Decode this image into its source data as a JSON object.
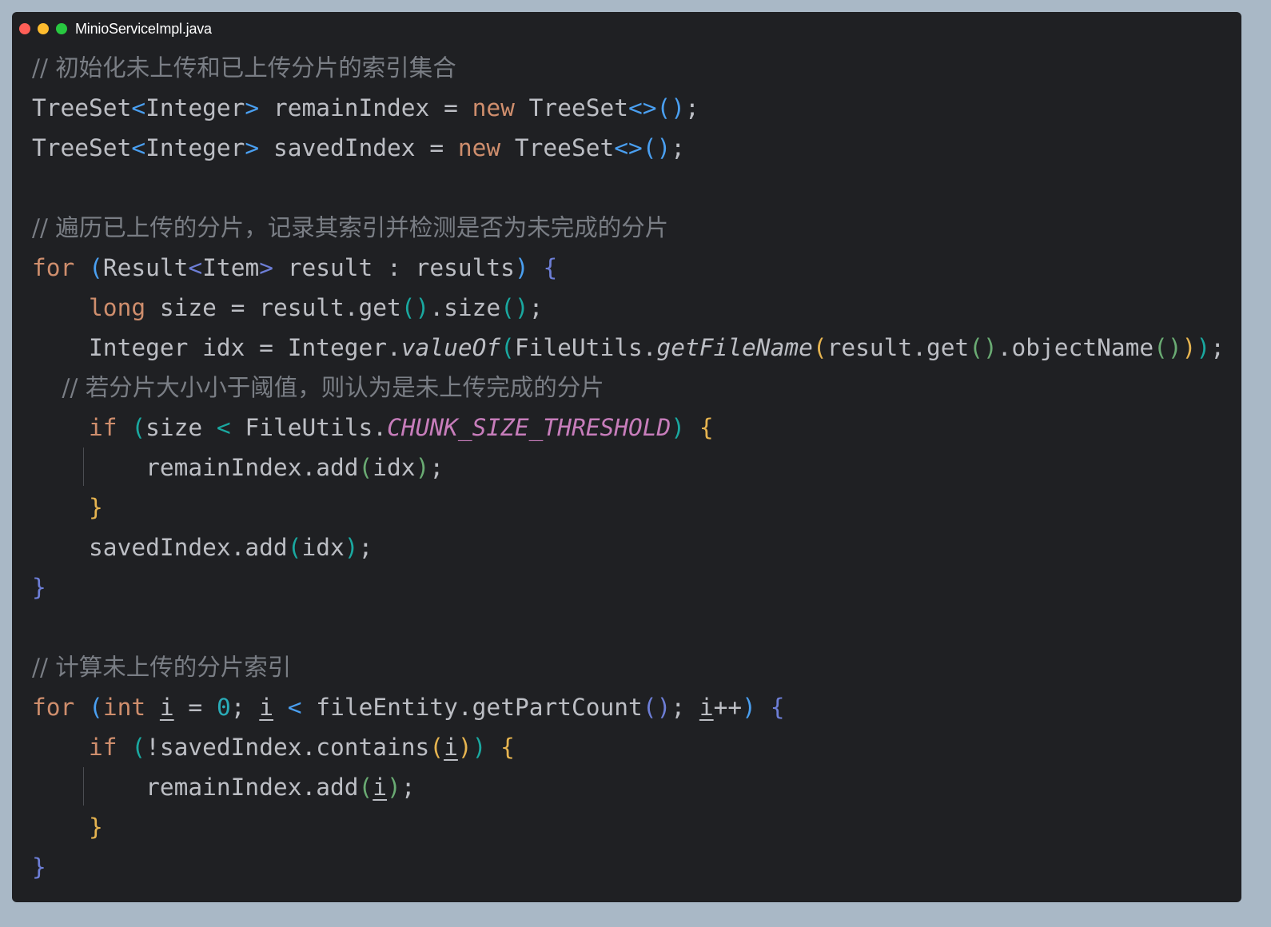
{
  "window": {
    "file_name": "MinioServiceImpl.java",
    "traffic_lights": {
      "close": "#ff5f57",
      "minimize": "#febc2e",
      "maximize": "#28c840"
    }
  },
  "colors": {
    "default": "#bcbec4",
    "keyword": "#cf8e6d",
    "comment": "#7a7e85",
    "number": "#2aacb8",
    "static_field": "#c77dbb",
    "brace_purple": "#6d7ed6",
    "brace_blue": "#4a9ff0",
    "brace_teal": "#1aa8a0",
    "brace_yellow": "#e6b450",
    "brace_green": "#6aab73"
  },
  "code_lines": [
    [
      {
        "t": "// 初始化未上传和已上传分片的索引集合",
        "k": "comment"
      }
    ],
    [
      {
        "t": "TreeSet",
        "k": "default"
      },
      {
        "t": "<",
        "k": "brace_blue"
      },
      {
        "t": "Integer",
        "k": "default"
      },
      {
        "t": ">",
        "k": "brace_blue"
      },
      {
        "t": " remainIndex = ",
        "k": "default"
      },
      {
        "t": "new",
        "k": "keyword"
      },
      {
        "t": " TreeSet",
        "k": "default"
      },
      {
        "t": "<>()",
        "k": "brace_blue"
      },
      {
        "t": ";",
        "k": "default"
      }
    ],
    [
      {
        "t": "TreeSet",
        "k": "default"
      },
      {
        "t": "<",
        "k": "brace_blue"
      },
      {
        "t": "Integer",
        "k": "default"
      },
      {
        "t": ">",
        "k": "brace_blue"
      },
      {
        "t": " savedIndex = ",
        "k": "default"
      },
      {
        "t": "new",
        "k": "keyword"
      },
      {
        "t": " TreeSet",
        "k": "default"
      },
      {
        "t": "<>()",
        "k": "brace_blue"
      },
      {
        "t": ";",
        "k": "default"
      }
    ],
    [],
    [
      {
        "t": "// 遍历已上传的分片，记录其索引并检测是否为未完成的分片",
        "k": "comment"
      }
    ],
    [
      {
        "t": "for",
        "k": "keyword"
      },
      {
        "t": " ",
        "k": "default"
      },
      {
        "t": "(",
        "k": "brace_blue"
      },
      {
        "t": "Result",
        "k": "default"
      },
      {
        "t": "<",
        "k": "brace_purple"
      },
      {
        "t": "Item",
        "k": "default"
      },
      {
        "t": ">",
        "k": "brace_purple"
      },
      {
        "t": " result : results",
        "k": "default"
      },
      {
        "t": ")",
        "k": "brace_blue"
      },
      {
        "t": " ",
        "k": "default"
      },
      {
        "t": "{",
        "k": "brace_purple"
      }
    ],
    [
      {
        "t": "    ",
        "k": "default"
      },
      {
        "t": "long",
        "k": "keyword"
      },
      {
        "t": " size = result.get",
        "k": "default"
      },
      {
        "t": "()",
        "k": "brace_teal"
      },
      {
        "t": ".size",
        "k": "default"
      },
      {
        "t": "()",
        "k": "brace_teal"
      },
      {
        "t": ";",
        "k": "default"
      }
    ],
    [
      {
        "t": "    Integer idx = Integer.",
        "k": "default"
      },
      {
        "t": "valueOf",
        "k": "default",
        "s": "ital"
      },
      {
        "t": "(",
        "k": "brace_teal"
      },
      {
        "t": "FileUtils.",
        "k": "default"
      },
      {
        "t": "getFileName",
        "k": "default",
        "s": "ital"
      },
      {
        "t": "(",
        "k": "brace_yellow"
      },
      {
        "t": "result.get",
        "k": "default"
      },
      {
        "t": "()",
        "k": "brace_green"
      },
      {
        "t": ".objectName",
        "k": "default"
      },
      {
        "t": "()",
        "k": "brace_green"
      },
      {
        "t": ")",
        "k": "brace_yellow"
      },
      {
        "t": ")",
        "k": "brace_teal"
      },
      {
        "t": ";",
        "k": "default"
      }
    ],
    [
      {
        "t": "    // 若分片大小小于阈值，则认为是未上传完成的分片",
        "k": "comment"
      }
    ],
    [
      {
        "t": "    ",
        "k": "default"
      },
      {
        "t": "if",
        "k": "keyword"
      },
      {
        "t": " ",
        "k": "default"
      },
      {
        "t": "(",
        "k": "brace_teal"
      },
      {
        "t": "size ",
        "k": "default"
      },
      {
        "t": "<",
        "k": "brace_teal"
      },
      {
        "t": " FileUtils.",
        "k": "default"
      },
      {
        "t": "CHUNK_SIZE_THRESHOLD",
        "k": "static_field",
        "s": "ital"
      },
      {
        "t": ")",
        "k": "brace_teal"
      },
      {
        "t": " ",
        "k": "default"
      },
      {
        "t": "{",
        "k": "brace_yellow"
      }
    ],
    [
      {
        "t": "        remainIndex.add",
        "k": "default"
      },
      {
        "t": "(",
        "k": "brace_green"
      },
      {
        "t": "idx",
        "k": "default"
      },
      {
        "t": ")",
        "k": "brace_green"
      },
      {
        "t": ";",
        "k": "default"
      }
    ],
    [
      {
        "t": "    ",
        "k": "default"
      },
      {
        "t": "}",
        "k": "brace_yellow"
      }
    ],
    [
      {
        "t": "    savedIndex.add",
        "k": "default"
      },
      {
        "t": "(",
        "k": "brace_teal"
      },
      {
        "t": "idx",
        "k": "default"
      },
      {
        "t": ")",
        "k": "brace_teal"
      },
      {
        "t": ";",
        "k": "default"
      }
    ],
    [
      {
        "t": "}",
        "k": "brace_purple"
      }
    ],
    [],
    [
      {
        "t": "// 计算未上传的分片索引",
        "k": "comment"
      }
    ],
    [
      {
        "t": "for",
        "k": "keyword"
      },
      {
        "t": " ",
        "k": "default"
      },
      {
        "t": "(",
        "k": "brace_blue"
      },
      {
        "t": "int",
        "k": "keyword"
      },
      {
        "t": " ",
        "k": "default"
      },
      {
        "t": "i",
        "k": "default",
        "s": "ul"
      },
      {
        "t": " = ",
        "k": "default"
      },
      {
        "t": "0",
        "k": "number"
      },
      {
        "t": "; ",
        "k": "default"
      },
      {
        "t": "i",
        "k": "default",
        "s": "ul"
      },
      {
        "t": " ",
        "k": "default"
      },
      {
        "t": "<",
        "k": "brace_blue"
      },
      {
        "t": " fileEntity.getPartCount",
        "k": "default"
      },
      {
        "t": "()",
        "k": "brace_purple"
      },
      {
        "t": "; ",
        "k": "default"
      },
      {
        "t": "i",
        "k": "default",
        "s": "ul"
      },
      {
        "t": "++",
        "k": "default"
      },
      {
        "t": ")",
        "k": "brace_blue"
      },
      {
        "t": " ",
        "k": "default"
      },
      {
        "t": "{",
        "k": "brace_purple"
      }
    ],
    [
      {
        "t": "    ",
        "k": "default"
      },
      {
        "t": "if",
        "k": "keyword"
      },
      {
        "t": " ",
        "k": "default"
      },
      {
        "t": "(",
        "k": "brace_teal"
      },
      {
        "t": "!savedIndex.contains",
        "k": "default"
      },
      {
        "t": "(",
        "k": "brace_yellow"
      },
      {
        "t": "i",
        "k": "default",
        "s": "ul"
      },
      {
        "t": ")",
        "k": "brace_yellow"
      },
      {
        "t": ")",
        "k": "brace_teal"
      },
      {
        "t": " ",
        "k": "default"
      },
      {
        "t": "{",
        "k": "brace_yellow"
      }
    ],
    [
      {
        "t": "        remainIndex.add",
        "k": "default"
      },
      {
        "t": "(",
        "k": "brace_green"
      },
      {
        "t": "i",
        "k": "default",
        "s": "ul"
      },
      {
        "t": ")",
        "k": "brace_green"
      },
      {
        "t": ";",
        "k": "default"
      }
    ],
    [
      {
        "t": "    ",
        "k": "default"
      },
      {
        "t": "}",
        "k": "brace_yellow"
      }
    ],
    [
      {
        "t": "}",
        "k": "brace_purple"
      }
    ]
  ]
}
